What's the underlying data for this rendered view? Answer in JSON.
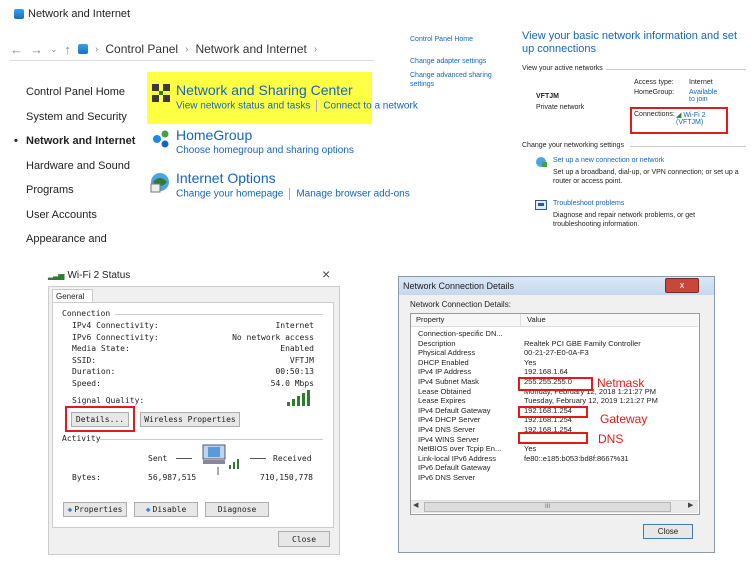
{
  "cp": {
    "window_title": "Network and Internet",
    "breadcrumb": [
      "Control Panel",
      "Network and Internet"
    ],
    "nav_items": [
      "Control Panel Home",
      "System and Security",
      "Network and Internet",
      "Hardware and Sound",
      "Programs",
      "User Accounts",
      "Appearance and"
    ],
    "categories": [
      {
        "title": "Network and Sharing Center",
        "links": [
          "View network status and tasks",
          "Connect to a network"
        ]
      },
      {
        "title": "HomeGroup",
        "links": [
          "Choose homegroup and sharing options"
        ]
      },
      {
        "title": "Internet Options",
        "links": [
          "Change your homepage",
          "Manage browser add-ons"
        ]
      }
    ]
  },
  "nsc": {
    "left_links": [
      "Control Panel Home",
      "Change adapter settings",
      "Change advanced sharing settings"
    ],
    "title": "View your basic network information and set up connections",
    "active_label": "View your active networks",
    "network_name": "VFTJM",
    "network_type": "Private network",
    "access_type_label": "Access type:",
    "access_type_value": "Internet",
    "homegroup_label": "HomeGroup:",
    "homegroup_value": "Available to join",
    "connections_label": "Connections:",
    "connections_value": "Wi-Fi 2 (VFTJM)",
    "change_label": "Change your networking settings",
    "tasks": [
      {
        "link": "Set up a new connection or network",
        "desc": "Set up a broadband, dial-up, or VPN connection; or set up a router or access point."
      },
      {
        "link": "Troubleshoot problems",
        "desc": "Diagnose and repair network problems, or get troubleshooting information."
      }
    ]
  },
  "wifi": {
    "title": "Wi-Fi 2 Status",
    "close": "×",
    "tab": "General",
    "connection_label": "Connection",
    "rows": [
      {
        "k": "IPv4 Connectivity:",
        "v": "Internet"
      },
      {
        "k": "IPv6 Connectivity:",
        "v": "No network access"
      },
      {
        "k": "Media State:",
        "v": "Enabled"
      },
      {
        "k": "SSID:",
        "v": "VFTJM"
      },
      {
        "k": "Duration:",
        "v": "00:50:13"
      },
      {
        "k": "Speed:",
        "v": "54.0 Mbps"
      }
    ],
    "signal_label": "Signal Quality:",
    "details_btn": "Details...",
    "wireless_btn": "Wireless Properties",
    "activity_label": "Activity",
    "sent": "Sent",
    "received": "Received",
    "bytes_label": "Bytes:",
    "bytes_sent": "56,987,515",
    "bytes_received": "710,150,778",
    "properties_btn": "Properties",
    "disable_btn": "Disable",
    "diagnose_btn": "Diagnose",
    "close_btn": "Close"
  },
  "ncd": {
    "title": "Network Connection Details",
    "close": "x",
    "section": "Network Connection Details:",
    "col_property": "Property",
    "col_value": "Value",
    "rows": [
      {
        "p": "Connection-specific DN...",
        "v": ""
      },
      {
        "p": "Description",
        "v": "Realtek PCI GBE Family Controller"
      },
      {
        "p": "Physical Address",
        "v": "00-21-27-E0-0A-F3"
      },
      {
        "p": "DHCP Enabled",
        "v": "Yes"
      },
      {
        "p": "IPv4 IP Address",
        "v": "192.168.1.64"
      },
      {
        "p": "IPv4 Subnet Mask",
        "v": "255.255.255.0"
      },
      {
        "p": "Lease Obtained",
        "v": "Monday, February 12, 2018 1:21:27 PM"
      },
      {
        "p": "Lease Expires",
        "v": "Tuesday, February 12, 2019 1:21:27 PM"
      },
      {
        "p": "IPv4 Default Gateway",
        "v": "192.168.1.254"
      },
      {
        "p": "IPv4 DHCP Server",
        "v": "192.168.1.254"
      },
      {
        "p": "IPv4 DNS Server",
        "v": "192.168.1.254"
      },
      {
        "p": "IPv4 WINS Server",
        "v": ""
      },
      {
        "p": "NetBIOS over Tcpip En...",
        "v": "Yes"
      },
      {
        "p": "Link-local IPv6 Address",
        "v": "fe80::e185:b053:bd8f:8667%31"
      },
      {
        "p": "IPv6 Default Gateway",
        "v": ""
      },
      {
        "p": "IPv6 DNS Server",
        "v": ""
      }
    ],
    "scroll_thumb": "III",
    "close_btn": "Close",
    "annotations": {
      "netmask": "Netmask",
      "gateway": "Gateway",
      "dns": "DNS"
    }
  },
  "colors": {
    "highlight": "#ffff44",
    "annotation_red": "#e21a1a",
    "link_blue": "#1565c0"
  }
}
